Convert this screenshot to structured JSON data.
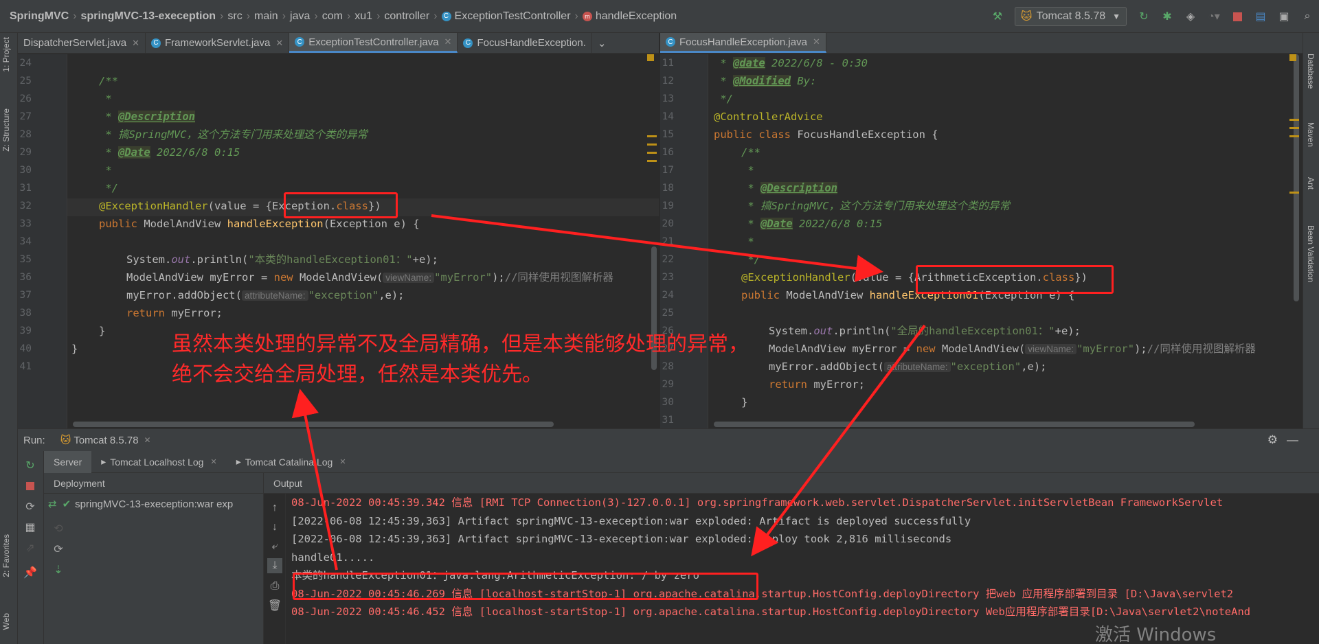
{
  "breadcrumb": [
    "SpringMVC",
    "springMVC-13-exeception",
    "src",
    "main",
    "java",
    "com",
    "xu1",
    "controller",
    "ExceptionTestController",
    "handleException"
  ],
  "run_config": "Tomcat 8.5.78",
  "left_tabs": {
    "project": "1: Project",
    "structure": "Z: Structure",
    "favorites": "2: Favorites",
    "web": "Web"
  },
  "right_tabs": {
    "database": "Database",
    "maven": "Maven",
    "ant": "Ant",
    "bean": "Bean Validation"
  },
  "left_editor": {
    "tabs": [
      "DispatcherServlet.java",
      "FrameworkServlet.java",
      "ExceptionTestController.java",
      "FocusHandleException."
    ],
    "active_tab": 2,
    "lines": [
      24,
      25,
      26,
      27,
      28,
      29,
      30,
      31,
      32,
      33,
      34,
      35,
      36,
      37,
      38,
      39,
      40,
      41
    ],
    "code": {
      "l25": "/**",
      "l26": " *",
      "l27_pre": " * ",
      "l27_tag": "@Description",
      "l28": " * 搞SpringMVC，这个方法专门用来处理这个类的异常",
      "l29_pre": " * ",
      "l29_tag": "@Date",
      "l29_post": " 2022/6/8 0:15",
      "l30": " *",
      "l31": " */",
      "l32_ann": "@ExceptionHandler",
      "l32_a": "(value = {",
      "l32_cls": "Exception",
      "l32_dot": ".",
      "l32_kw": "class",
      "l32_b": "})",
      "l33_kw": "public",
      "l33_a": " ModelAndView ",
      "l33_fn": "handleException",
      "l33_b": "(Exception e) {",
      "l35_a": "System.",
      "l35_fld": "out",
      "l35_b": ".println(",
      "l35_str": "\"本类的handleException01：\"",
      "l35_c": "+e);",
      "l36_a": "ModelAndView myError = ",
      "l36_kw": "new",
      "l36_b": " ModelAndView(",
      "l36_hint": "viewName:",
      "l36_str": "\"myError\"",
      "l36_c": ");",
      "l36_cmt": "//同样使用视图解析器",
      "l37_a": "myError.addObject(",
      "l37_hint": "attributeName:",
      "l37_str": "\"exception\"",
      "l37_b": ",e);",
      "l38_kw": "return",
      "l38_a": " myError;",
      "l39": "}",
      "l40": "}"
    }
  },
  "right_editor": {
    "tabs": [
      "FocusHandleException.java"
    ],
    "lines": [
      11,
      12,
      13,
      14,
      15,
      16,
      17,
      18,
      19,
      20,
      21,
      22,
      23,
      24,
      25,
      26,
      27,
      28,
      29,
      30,
      31
    ],
    "code": {
      "l11_pre": " * ",
      "l11_tag": "@date",
      "l11_post": " 2022/6/8 - 0:30",
      "l12_pre": " * ",
      "l12_tag": "@Modified",
      "l12_post": " By:",
      "l13": " */",
      "l14": "@ControllerAdvice",
      "l15_kw": "public class",
      "l15_a": " FocusHandleException {",
      "l16": "/**",
      "l17": " *",
      "l18_pre": " * ",
      "l18_tag": "@Description",
      "l19": " * 搞SpringMVC，这个方法专门用来处理这个类的异常",
      "l20_pre": " * ",
      "l20_tag": "@Date",
      "l20_post": " 2022/6/8 0:15",
      "l21": " *",
      "l22": " */",
      "l23_ann": "@ExceptionHandler",
      "l23_a": "(value = {",
      "l23_cls": "ArithmeticException",
      "l23_dot": ".",
      "l23_kw": "class",
      "l23_b": "})",
      "l24_kw": "public",
      "l24_a": " ModelAndView ",
      "l24_fn": "handleException01",
      "l24_b": "(Exception e) {",
      "l26_a": "System.",
      "l26_fld": "out",
      "l26_b": ".println(",
      "l26_str": "\"全局的handleException01：\"",
      "l26_c": "+e);",
      "l27_a": "ModelAndView myError = ",
      "l27_kw": "new",
      "l27_b": " ModelAndView(",
      "l27_hint": "viewName:",
      "l27_str": "\"myError\"",
      "l27_c": ");",
      "l27_cmt": "//同样使用视图解析器",
      "l28_a": "myError.addObject(",
      "l28_hint": "attributeName:",
      "l28_str": "\"exception\"",
      "l28_b": ",e);",
      "l29_kw": "return",
      "l29_a": " myError;",
      "l30": "}"
    }
  },
  "run": {
    "label": "Run:",
    "tab": "Tomcat 8.5.78",
    "subtabs": [
      "Server",
      "Tomcat Localhost Log",
      "Tomcat Catalina Log"
    ],
    "deployment_label": "Deployment",
    "output_label": "Output",
    "deployment_item": "springMVC-13-exeception:war exp",
    "console": [
      {
        "text": "08-Jun-2022 00:45:39.342 信息 [RMI TCP Connection(3)-127.0.0.1] org.springframework.web.servlet.DispatcherServlet.initServletBean FrameworkServlet",
        "type": "err"
      },
      {
        "text": "[2022-06-08 12:45:39,363] Artifact springMVC-13-exeception:war exploded: Artifact is deployed successfully",
        "type": "out"
      },
      {
        "text": "[2022-06-08 12:45:39,363] Artifact springMVC-13-exeception:war exploded: Deploy took 2,816 milliseconds",
        "type": "out"
      },
      {
        "text": "handle01.....",
        "type": "out"
      },
      {
        "text": "本类的handleException01：java.lang.ArithmeticException: / by zero",
        "type": "out"
      },
      {
        "text": "08-Jun-2022 00:45:46.269 信息 [localhost-startStop-1] org.apache.catalina.startup.HostConfig.deployDirectory 把web 应用程序部署到目录 [D:\\Java\\servlet2",
        "type": "err"
      },
      {
        "text": "08-Jun-2022 00:45:46.452 信息 [localhost-startStop-1] org.apache.catalina.startup.HostConfig.deployDirectory Web应用程序部署目录[D:\\Java\\servlet2\\noteAnd",
        "type": "err"
      }
    ]
  },
  "annotation_note": "虽然本类处理的异常不及全局精确，但是本类能够处理的异常，绝不会交给全局处理，任然是本类优先。",
  "watermark": "激活 Windows",
  "colors": {
    "annotation": "#ff2020",
    "keyword": "#cc7832",
    "string": "#6a8759",
    "comment": "#629755",
    "error_output": "#ff6b68"
  }
}
